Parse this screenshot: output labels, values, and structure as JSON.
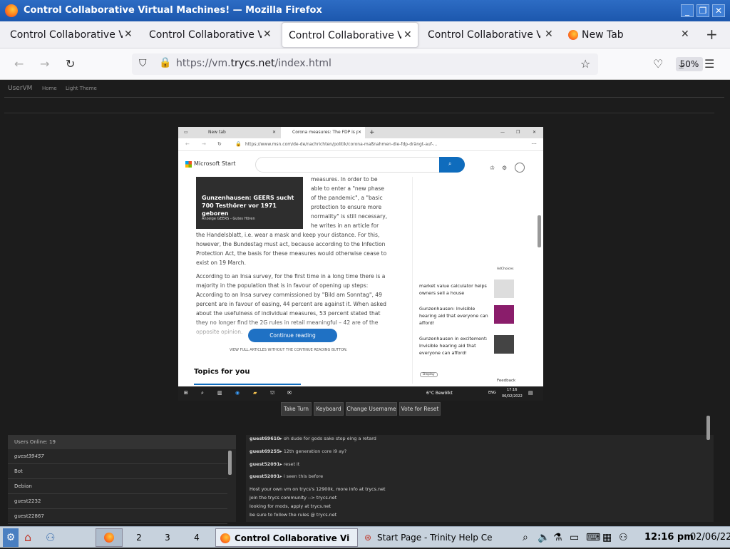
{
  "window": {
    "title": "Control Collaborative Virtual Machines! — Mozilla Firefox"
  },
  "tabs": [
    {
      "label": "Control Collaborative Vi"
    },
    {
      "label": "Control Collaborative Vi"
    },
    {
      "label": "Control Collaborative Vi"
    },
    {
      "label": "Control Collaborative Vi"
    },
    {
      "label": "New Tab"
    }
  ],
  "urlbar": {
    "url_prefix": "https://vm.",
    "url_domain": "trycs.net",
    "url_path": "/index.html",
    "zoom": "50%"
  },
  "site": {
    "brand": "UserVM",
    "nav_home": "Home",
    "nav_theme": "Light Theme"
  },
  "vm": {
    "browser": {
      "tab_new": "New tab",
      "tab_active": "Corona measures: The FDP is pu",
      "address": "https://www.msn.com/de-de/nachrichten/politik/corona-maßnahmen-die-fdp-drängt-auf-..."
    },
    "brand": "Microsoft Start",
    "promo": {
      "title": "Gunzenhausen: GEERS sucht 700 Testhörer vor 1971 geboren",
      "attribution": "Anzeige   GEERS - Gutes Hören"
    },
    "article_col": [
      "measures. In order to be",
      "able to enter a \"new phase",
      "of the pandemic\", a \"basic",
      "protection to ensure more",
      "normality\" is still necessary,",
      "he writes in an article for"
    ],
    "article_p1_rest": "the Handelsblatt, i.e. wear a mask and keep your distance. For this, however, the Bundestag must act, because according to the Infection Protection Act, the basis for these measures would otherwise cease to exist on 19 March.",
    "article_p2": "According to an Insa survey, for the first time in a long time there is a majority in the population that is in favour of opening up steps: According to an Insa survey commissioned by \"Bild am Sonntag\", 49 percent are in favour of easing, 44 percent are against it. When asked about the usefulness of individual measures, 53 percent stated that they no longer find the 2G rules in retail meaningful – 42 are of the opposite opinion.",
    "continue_label": "Continue reading",
    "full_note": "VIEW FULL ARTICLES WITHOUT THE CONTINUE READING BUTTON.",
    "topics": "Topics for you",
    "adchoices": "AdChoices",
    "ads": [
      {
        "text": "market value calculator helps owners sell a house"
      },
      {
        "text": "Gunzenhausen: Invisible hearing aid that everyone can afford!"
      },
      {
        "text": "Gunzenhausen in excitement: Invisible hearing aid that everyone can afford!"
      }
    ],
    "display": "Display",
    "feedback": "Feedback",
    "taskbar": {
      "weather": "6°C  Bewölkt",
      "lang": "ENG",
      "time": "17:16",
      "date": "06/02/2022"
    }
  },
  "vm_buttons": [
    "Take Turn",
    "Keyboard",
    "Change Username",
    "Vote for Reset"
  ],
  "users": {
    "header": "Users Online: 19",
    "list": [
      "guest39457",
      "Bot",
      "Debian",
      "guest2232",
      "guest22867"
    ]
  },
  "chat": [
    {
      "user": "guest69610▸",
      "msg": "oh dude for gods sake stop eing a retard"
    },
    {
      "user": "guest69255▸",
      "msg": "12th generation core i9 ay?"
    },
    {
      "user": "guest52091▸",
      "msg": "reset it"
    },
    {
      "user": "guest52091▸",
      "msg": "i seen this before"
    }
  ],
  "system_msgs": [
    "Host your own vm on trycs's 12900k, more info at trycs.net",
    "join the trycs community --> trycs.net",
    "looking for mods, apply at trycs.net",
    "be sure to follow the rules @ trycs.net"
  ],
  "taskbar": {
    "workspaces": [
      "2",
      "3",
      "4"
    ],
    "windows": [
      "Control Collaborative Vi",
      "Start Page - Trinity Help Ce"
    ],
    "time": "12:16 pm",
    "date": "02/06/22"
  }
}
